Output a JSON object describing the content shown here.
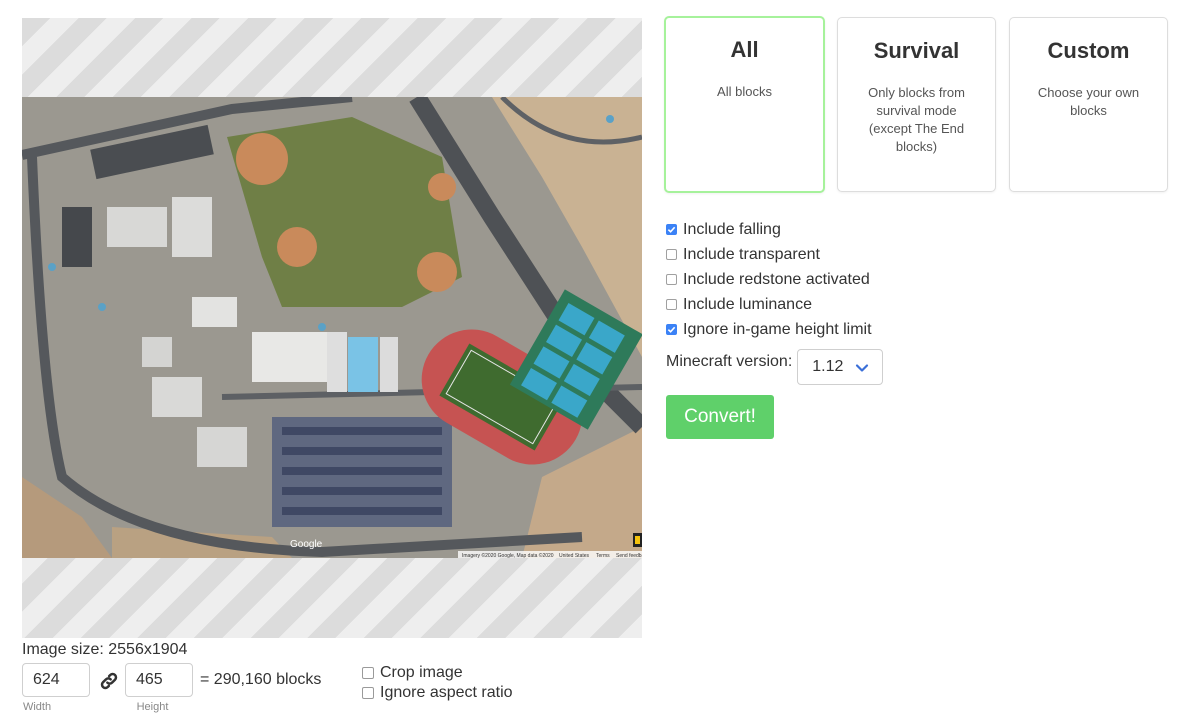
{
  "image": {
    "size_text": "Image size: 2556x1904",
    "width_value": "624",
    "height_value": "465",
    "blocks_text": "= 290,160 blocks",
    "width_label": "Width",
    "height_label": "Height",
    "map_labels": [
      "Google",
      "Imagery ©2020 Google, Map data ©2020",
      "United States",
      "Terms",
      "Send feedback"
    ]
  },
  "crop_options": [
    {
      "label": "Crop image",
      "checked": false
    },
    {
      "label": "Ignore aspect ratio",
      "checked": false
    }
  ],
  "modes": [
    {
      "title": "All",
      "desc": "All blocks",
      "selected": true
    },
    {
      "title": "Survival",
      "desc": "Only blocks from survival mode (except The End blocks)",
      "selected": false
    },
    {
      "title": "Custom",
      "desc": "Choose your own blocks",
      "selected": false
    }
  ],
  "options": [
    {
      "label": "Include falling",
      "checked": true
    },
    {
      "label": "Include transparent",
      "checked": false
    },
    {
      "label": "Include redstone activated",
      "checked": false
    },
    {
      "label": "Include luminance",
      "checked": false
    },
    {
      "label": "Ignore in-game height limit",
      "checked": true
    }
  ],
  "version": {
    "label": "Minecraft version:",
    "value": "1.12"
  },
  "convert_label": "Convert!",
  "colors": {
    "accent_green": "#5fd06a",
    "selected_border": "#a6f29b",
    "checkbox_blue": "#3b82f6"
  },
  "icons": [
    "link-icon",
    "chevron-down-icon",
    "check-icon"
  ]
}
